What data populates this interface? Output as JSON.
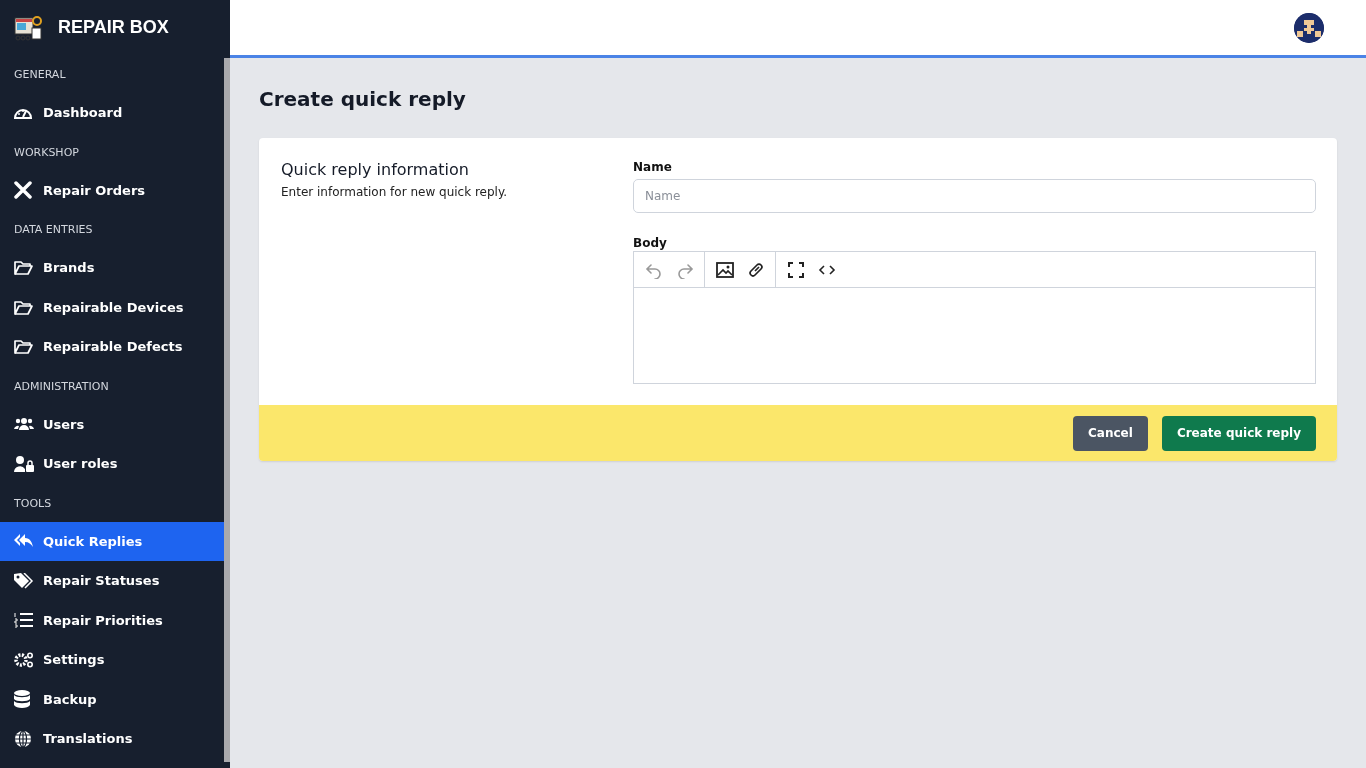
{
  "brand": {
    "name": "REPAIR BOX"
  },
  "sidebar": {
    "items": [
      {
        "kind": "section",
        "label": "GENERAL"
      },
      {
        "kind": "link",
        "label": "Dashboard",
        "selected": false
      },
      {
        "kind": "section",
        "label": "WORKSHOP"
      },
      {
        "kind": "link",
        "label": "Repair Orders",
        "selected": false
      },
      {
        "kind": "section",
        "label": "DATA ENTRIES"
      },
      {
        "kind": "link",
        "label": "Brands",
        "selected": false
      },
      {
        "kind": "link",
        "label": "Repairable Devices",
        "selected": false
      },
      {
        "kind": "link",
        "label": "Repairable Defects",
        "selected": false
      },
      {
        "kind": "section",
        "label": "ADMINISTRATION"
      },
      {
        "kind": "link",
        "label": "Users",
        "selected": false
      },
      {
        "kind": "link",
        "label": "User roles",
        "selected": false
      },
      {
        "kind": "section",
        "label": "TOOLS"
      },
      {
        "kind": "link",
        "label": "Quick Replies",
        "selected": true
      },
      {
        "kind": "link",
        "label": "Repair Statuses",
        "selected": false
      },
      {
        "kind": "link",
        "label": "Repair Priorities",
        "selected": false
      },
      {
        "kind": "link",
        "label": "Settings",
        "selected": false
      },
      {
        "kind": "link",
        "label": "Backup",
        "selected": false
      },
      {
        "kind": "link",
        "label": "Translations",
        "selected": false
      }
    ]
  },
  "page": {
    "title": "Create quick reply"
  },
  "form": {
    "section_title": "Quick reply information",
    "section_description": "Enter information for new quick reply.",
    "name_field": {
      "label": "Name",
      "placeholder": "Name"
    },
    "body_field": {
      "label": "Body",
      "toolbar": [
        {
          "disabled": true
        },
        {
          "disabled": true
        },
        {
          "disabled": false
        },
        {
          "disabled": false
        },
        {
          "disabled": false
        },
        {
          "disabled": false
        }
      ]
    },
    "buttons": [
      {
        "kind": "secondary",
        "label": "Cancel"
      },
      {
        "kind": "primary",
        "label": "Create quick reply"
      }
    ]
  }
}
